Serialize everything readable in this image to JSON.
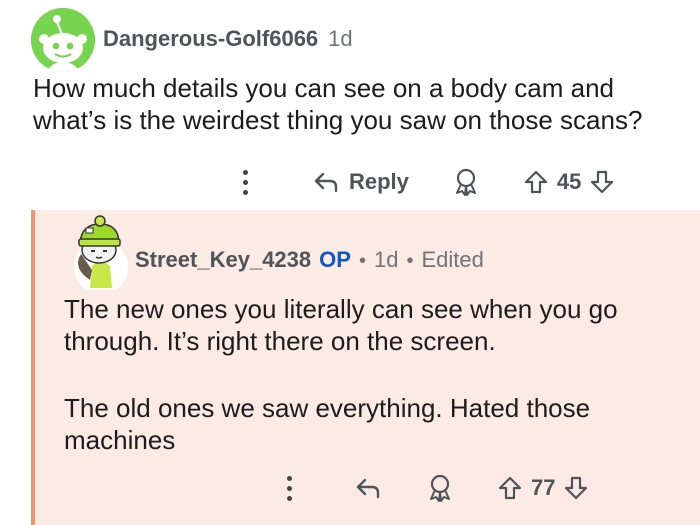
{
  "comment": {
    "username": "Dangerous-Golf6066",
    "age": "1d",
    "text": "How much details you can see on a body cam and what’s is the weirdest thing you saw on those scans?",
    "reply_label": "Reply",
    "score": "45",
    "avatar_color": "#77d44f"
  },
  "reply": {
    "username": "Street_Key_4238",
    "op_badge": "OP",
    "separator": "•",
    "age": "1d",
    "edited": "Edited",
    "paragraphs": [
      "The new ones you literally can see when you go through. It’s right there on the screen.",
      "The old ones we saw everything. Hated those machines"
    ],
    "score": "77",
    "thread_color": "#f0946f",
    "background": "#fcebe5"
  }
}
